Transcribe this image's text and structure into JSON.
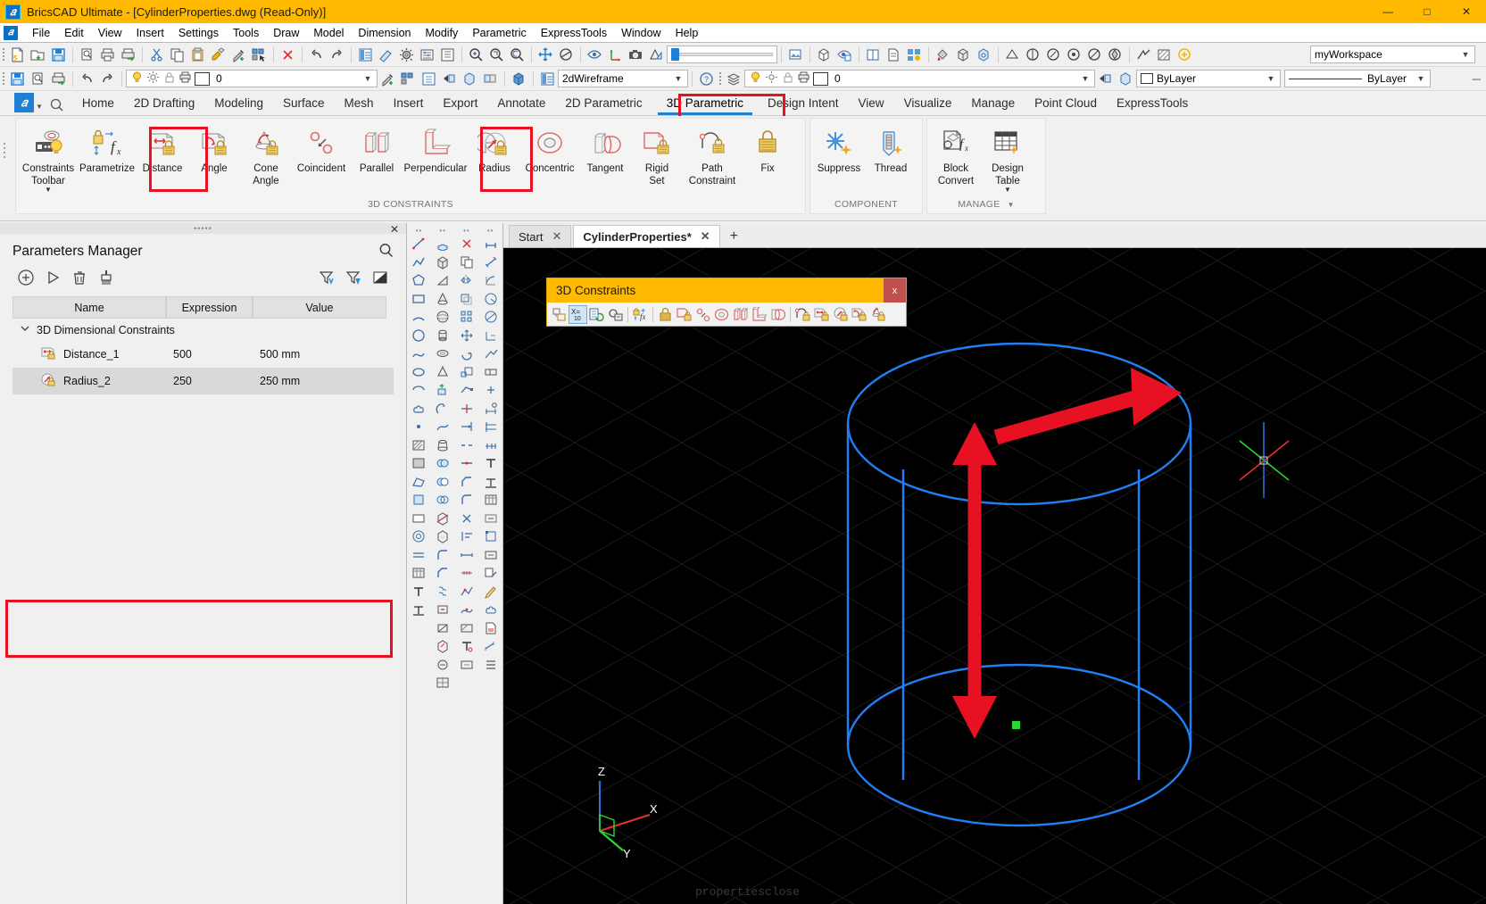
{
  "window": {
    "title": "BricsCAD Ultimate - [CylinderProperties.dwg (Read-Only)]",
    "logo": "bricscad-logo",
    "minimize": "—",
    "maximize": "□",
    "close": "✕"
  },
  "menubar": {
    "items": [
      "File",
      "Edit",
      "View",
      "Insert",
      "Settings",
      "Tools",
      "Draw",
      "Model",
      "Dimension",
      "Modify",
      "Parametric",
      "ExpressTools",
      "Window",
      "Help"
    ]
  },
  "toolbars": {
    "row1_icons": [
      "new-icon",
      "open-icon",
      "save-icon",
      "print-preview-icon",
      "print-icon",
      "plot-icon",
      "cut-icon",
      "copy-icon",
      "paste-icon",
      "match-properties-icon",
      "eyedropper-icon",
      "select-similar-icon",
      "erase-icon",
      "undo-icon",
      "redo-icon",
      "properties-icon",
      "clean-icon",
      "settings-icon",
      "options-icon",
      "explorer-icon",
      "zoom-window-icon",
      "zoom-previous-icon",
      "pan-icon",
      "orbit-icon",
      "visual-styles-icon",
      "lights-icon",
      "camera-icon",
      "render-icon",
      "transparency-slider",
      "image-icon",
      "box-icon",
      "save-view-icon",
      "tile-icon",
      "sheet-icon",
      "layout-icon",
      "paint-icon",
      "solid-icon",
      "shell-icon",
      "measure-icon",
      "dim-icon",
      "leader-icon",
      "table-icon",
      "text-icon",
      "hatch-icon",
      "block-icon",
      "attribute-icon",
      "xref-icon",
      "link-icon"
    ],
    "workspace_value": "myWorkspace",
    "row2": {
      "save_icon": "save-icon",
      "preview_icon": "print-preview-icon",
      "plot_icon": "plot-icon",
      "undo_icon": "undo-icon",
      "redo_icon": "redo-icon",
      "layer_value": "0",
      "layer_icons": [
        "lightbulb-icon",
        "sun-icon",
        "lock-icon",
        "printer-icon",
        "color-swatch"
      ],
      "visual_style_value": "2dWireframe",
      "help_icon": "help-icon",
      "layer2_value": "0",
      "color_value": "ByLayer",
      "linetype_value": "ByLayer"
    }
  },
  "ribbon": {
    "quick_access_logo": "bricscad-logo",
    "search_icon": "search-icon",
    "tabs": [
      {
        "label": "Home",
        "active": false
      },
      {
        "label": "2D Drafting",
        "active": false
      },
      {
        "label": "Modeling",
        "active": false
      },
      {
        "label": "Surface",
        "active": false
      },
      {
        "label": "Mesh",
        "active": false
      },
      {
        "label": "Insert",
        "active": false
      },
      {
        "label": "Export",
        "active": false
      },
      {
        "label": "Annotate",
        "active": false
      },
      {
        "label": "2D Parametric",
        "active": false
      },
      {
        "label": "3D Parametric",
        "active": true
      },
      {
        "label": "Design Intent",
        "active": false
      },
      {
        "label": "View",
        "active": false
      },
      {
        "label": "Visualize",
        "active": false
      },
      {
        "label": "Manage",
        "active": false
      },
      {
        "label": "Point Cloud",
        "active": false
      },
      {
        "label": "ExpressTools",
        "active": false
      }
    ],
    "panels": [
      {
        "label": "3D CONSTRAINTS",
        "buttons": [
          {
            "label": "Constraints\nToolbar",
            "line1": "Constraints",
            "line2": "Toolbar",
            "icon": "constraints-toolbar-icon",
            "dropdown": true,
            "highlight": false
          },
          {
            "label": "Parametrize",
            "line1": "Parametrize",
            "line2": "",
            "icon": "parametrize-icon",
            "dropdown": false,
            "highlight": false
          },
          {
            "label": "Distance",
            "line1": "Distance",
            "line2": "",
            "icon": "distance-constraint-icon",
            "dropdown": false,
            "highlight": true
          },
          {
            "label": "Angle",
            "line1": "Angle",
            "line2": "",
            "icon": "angle-constraint-icon",
            "dropdown": false,
            "highlight": false
          },
          {
            "label": "Cone Angle",
            "line1": "Cone",
            "line2": "Angle",
            "icon": "cone-angle-constraint-icon",
            "dropdown": false,
            "highlight": false
          },
          {
            "label": "Coincident",
            "line1": "Coincident",
            "line2": "",
            "icon": "coincident-constraint-icon",
            "dropdown": false,
            "highlight": false
          },
          {
            "label": "Parallel",
            "line1": "Parallel",
            "line2": "",
            "icon": "parallel-constraint-icon",
            "dropdown": false,
            "highlight": false
          },
          {
            "label": "Perpendicular",
            "line1": "Perpendicular",
            "line2": "",
            "icon": "perpendicular-constraint-icon",
            "dropdown": false,
            "highlight": false
          },
          {
            "label": "Radius",
            "line1": "Radius",
            "line2": "",
            "icon": "radius-constraint-icon",
            "dropdown": false,
            "highlight": true
          },
          {
            "label": "Concentric",
            "line1": "Concentric",
            "line2": "",
            "icon": "concentric-constraint-icon",
            "dropdown": false,
            "highlight": false
          },
          {
            "label": "Tangent",
            "line1": "Tangent",
            "line2": "",
            "icon": "tangent-constraint-icon",
            "dropdown": false,
            "highlight": false
          },
          {
            "label": "Rigid Set",
            "line1": "Rigid",
            "line2": "Set",
            "icon": "rigid-set-icon",
            "dropdown": false,
            "highlight": false
          },
          {
            "label": "Path Constraint",
            "line1": "Path",
            "line2": "Constraint",
            "icon": "path-constraint-icon",
            "dropdown": false,
            "highlight": false
          },
          {
            "label": "Fix",
            "line1": "Fix",
            "line2": "",
            "icon": "fix-constraint-icon",
            "dropdown": false,
            "highlight": false
          }
        ]
      },
      {
        "label": "COMPONENT",
        "buttons": [
          {
            "label": "Suppress",
            "line1": "Suppress",
            "line2": "",
            "icon": "suppress-icon",
            "dropdown": false,
            "highlight": false
          },
          {
            "label": "Thread",
            "line1": "Thread",
            "line2": "",
            "icon": "thread-icon",
            "dropdown": false,
            "highlight": false
          }
        ]
      },
      {
        "label": "MANAGE",
        "buttons": [
          {
            "label": "Block Convert",
            "line1": "Block",
            "line2": "Convert",
            "icon": "block-convert-icon",
            "dropdown": false,
            "highlight": false
          },
          {
            "label": "Design Table",
            "line1": "Design",
            "line2": "Table",
            "icon": "design-table-icon",
            "dropdown": true,
            "highlight": false
          }
        ]
      }
    ]
  },
  "parameters_manager": {
    "title": "Parameters Manager",
    "search_icon": "search-icon",
    "close_icon": "close-icon",
    "toolbar_left": [
      {
        "name": "add-parameter-button",
        "icon": "plus-circle-icon"
      },
      {
        "name": "evaluate-button",
        "icon": "play-icon"
      },
      {
        "name": "delete-parameter-button",
        "icon": "trash-icon"
      },
      {
        "name": "purge-button",
        "icon": "brush-icon"
      }
    ],
    "toolbar_right": [
      {
        "name": "filter-expression-button",
        "icon": "filter-v-icon"
      },
      {
        "name": "filter-button",
        "icon": "filter-icon"
      },
      {
        "name": "contrast-button",
        "icon": "contrast-icon"
      }
    ],
    "columns": [
      "Name",
      "Expression",
      "Value"
    ],
    "group": {
      "label": "3D Dimensional Constraints",
      "expanded": true,
      "chevron": "chevron-down-icon"
    },
    "rows": [
      {
        "icon": "distance-param-icon",
        "name": "Distance_1",
        "expression": "500",
        "value": "500 mm"
      },
      {
        "icon": "radius-param-icon",
        "name": "Radius_2",
        "expression": "250",
        "value": "250 mm"
      }
    ]
  },
  "document_tabs": {
    "tabs": [
      {
        "label": "Start",
        "active": false,
        "close": "✕"
      },
      {
        "label": "CylinderProperties*",
        "active": true,
        "close": "✕"
      }
    ],
    "add_label": "+"
  },
  "floating_toolbar": {
    "title": "3D Constraints",
    "close_label": "x",
    "icons": [
      {
        "name": "constraints-bar-icon",
        "selected": false
      },
      {
        "name": "parameters-manager-icon",
        "selected": true
      },
      {
        "name": "design-table-icon",
        "selected": false
      },
      {
        "name": "constraint-settings-icon",
        "selected": false
      },
      {
        "name": "parametrize-icon",
        "selected": false
      },
      {
        "name": "fix-constraint-icon",
        "selected": false
      },
      {
        "name": "rigid-set-icon",
        "selected": false
      },
      {
        "name": "coincident-constraint-icon",
        "selected": false
      },
      {
        "name": "concentric-constraint-icon",
        "selected": false
      },
      {
        "name": "parallel-constraint-icon",
        "selected": false
      },
      {
        "name": "perpendicular-constraint-icon",
        "selected": false
      },
      {
        "name": "tangent-constraint-icon",
        "selected": false
      },
      {
        "name": "path-constraint-icon",
        "selected": false
      },
      {
        "name": "distance-constraint-icon",
        "selected": false
      },
      {
        "name": "radius-constraint-icon",
        "selected": false
      },
      {
        "name": "angle-constraint-icon",
        "selected": false
      },
      {
        "name": "cone-angle-constraint-icon",
        "selected": false
      }
    ]
  },
  "viewport": {
    "background": "#000000",
    "model_color": "#1f7ff5",
    "annotation_color": "#e81123",
    "grip_color": "#2fd52f",
    "ucs": {
      "x": "X",
      "y": "Y",
      "z": "Z"
    },
    "command_text": "propertiesclose",
    "annotations": [
      {
        "name": "radius-arrow",
        "type": "arrow",
        "color": "#e81123"
      },
      {
        "name": "height-arrow",
        "type": "double-arrow",
        "color": "#e81123"
      }
    ]
  },
  "highlights": {
    "color": "#e81123",
    "boxes": [
      "ribbon-tab-3d-parametric",
      "ribbon-button-distance",
      "ribbon-button-radius",
      "parameters-rows"
    ]
  }
}
